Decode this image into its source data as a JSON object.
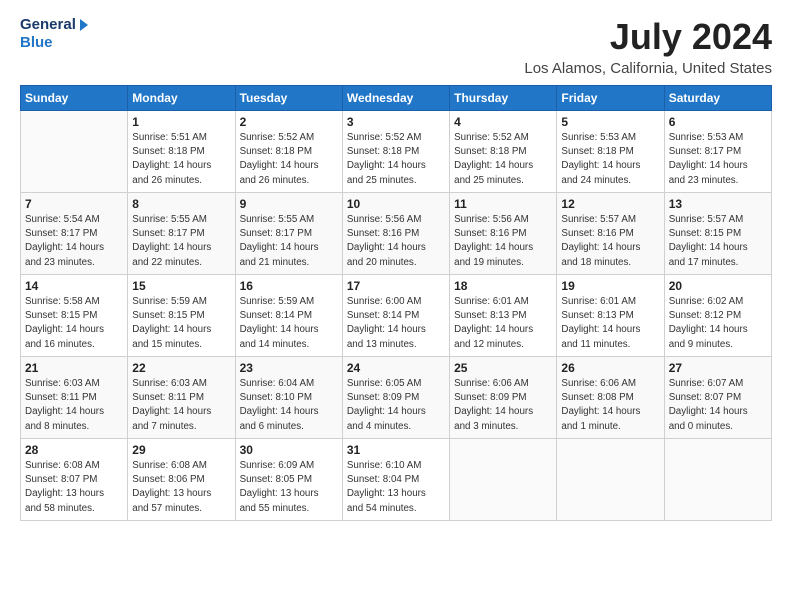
{
  "logo": {
    "general": "General",
    "blue": "Blue"
  },
  "title": "July 2024",
  "location": "Los Alamos, California, United States",
  "days_header": [
    "Sunday",
    "Monday",
    "Tuesday",
    "Wednesday",
    "Thursday",
    "Friday",
    "Saturday"
  ],
  "weeks": [
    [
      {
        "num": "",
        "info": ""
      },
      {
        "num": "1",
        "info": "Sunrise: 5:51 AM\nSunset: 8:18 PM\nDaylight: 14 hours\nand 26 minutes."
      },
      {
        "num": "2",
        "info": "Sunrise: 5:52 AM\nSunset: 8:18 PM\nDaylight: 14 hours\nand 26 minutes."
      },
      {
        "num": "3",
        "info": "Sunrise: 5:52 AM\nSunset: 8:18 PM\nDaylight: 14 hours\nand 25 minutes."
      },
      {
        "num": "4",
        "info": "Sunrise: 5:52 AM\nSunset: 8:18 PM\nDaylight: 14 hours\nand 25 minutes."
      },
      {
        "num": "5",
        "info": "Sunrise: 5:53 AM\nSunset: 8:18 PM\nDaylight: 14 hours\nand 24 minutes."
      },
      {
        "num": "6",
        "info": "Sunrise: 5:53 AM\nSunset: 8:17 PM\nDaylight: 14 hours\nand 23 minutes."
      }
    ],
    [
      {
        "num": "7",
        "info": "Sunrise: 5:54 AM\nSunset: 8:17 PM\nDaylight: 14 hours\nand 23 minutes."
      },
      {
        "num": "8",
        "info": "Sunrise: 5:55 AM\nSunset: 8:17 PM\nDaylight: 14 hours\nand 22 minutes."
      },
      {
        "num": "9",
        "info": "Sunrise: 5:55 AM\nSunset: 8:17 PM\nDaylight: 14 hours\nand 21 minutes."
      },
      {
        "num": "10",
        "info": "Sunrise: 5:56 AM\nSunset: 8:16 PM\nDaylight: 14 hours\nand 20 minutes."
      },
      {
        "num": "11",
        "info": "Sunrise: 5:56 AM\nSunset: 8:16 PM\nDaylight: 14 hours\nand 19 minutes."
      },
      {
        "num": "12",
        "info": "Sunrise: 5:57 AM\nSunset: 8:16 PM\nDaylight: 14 hours\nand 18 minutes."
      },
      {
        "num": "13",
        "info": "Sunrise: 5:57 AM\nSunset: 8:15 PM\nDaylight: 14 hours\nand 17 minutes."
      }
    ],
    [
      {
        "num": "14",
        "info": "Sunrise: 5:58 AM\nSunset: 8:15 PM\nDaylight: 14 hours\nand 16 minutes."
      },
      {
        "num": "15",
        "info": "Sunrise: 5:59 AM\nSunset: 8:15 PM\nDaylight: 14 hours\nand 15 minutes."
      },
      {
        "num": "16",
        "info": "Sunrise: 5:59 AM\nSunset: 8:14 PM\nDaylight: 14 hours\nand 14 minutes."
      },
      {
        "num": "17",
        "info": "Sunrise: 6:00 AM\nSunset: 8:14 PM\nDaylight: 14 hours\nand 13 minutes."
      },
      {
        "num": "18",
        "info": "Sunrise: 6:01 AM\nSunset: 8:13 PM\nDaylight: 14 hours\nand 12 minutes."
      },
      {
        "num": "19",
        "info": "Sunrise: 6:01 AM\nSunset: 8:13 PM\nDaylight: 14 hours\nand 11 minutes."
      },
      {
        "num": "20",
        "info": "Sunrise: 6:02 AM\nSunset: 8:12 PM\nDaylight: 14 hours\nand 9 minutes."
      }
    ],
    [
      {
        "num": "21",
        "info": "Sunrise: 6:03 AM\nSunset: 8:11 PM\nDaylight: 14 hours\nand 8 minutes."
      },
      {
        "num": "22",
        "info": "Sunrise: 6:03 AM\nSunset: 8:11 PM\nDaylight: 14 hours\nand 7 minutes."
      },
      {
        "num": "23",
        "info": "Sunrise: 6:04 AM\nSunset: 8:10 PM\nDaylight: 14 hours\nand 6 minutes."
      },
      {
        "num": "24",
        "info": "Sunrise: 6:05 AM\nSunset: 8:09 PM\nDaylight: 14 hours\nand 4 minutes."
      },
      {
        "num": "25",
        "info": "Sunrise: 6:06 AM\nSunset: 8:09 PM\nDaylight: 14 hours\nand 3 minutes."
      },
      {
        "num": "26",
        "info": "Sunrise: 6:06 AM\nSunset: 8:08 PM\nDaylight: 14 hours\nand 1 minute."
      },
      {
        "num": "27",
        "info": "Sunrise: 6:07 AM\nSunset: 8:07 PM\nDaylight: 14 hours\nand 0 minutes."
      }
    ],
    [
      {
        "num": "28",
        "info": "Sunrise: 6:08 AM\nSunset: 8:07 PM\nDaylight: 13 hours\nand 58 minutes."
      },
      {
        "num": "29",
        "info": "Sunrise: 6:08 AM\nSunset: 8:06 PM\nDaylight: 13 hours\nand 57 minutes."
      },
      {
        "num": "30",
        "info": "Sunrise: 6:09 AM\nSunset: 8:05 PM\nDaylight: 13 hours\nand 55 minutes."
      },
      {
        "num": "31",
        "info": "Sunrise: 6:10 AM\nSunset: 8:04 PM\nDaylight: 13 hours\nand 54 minutes."
      },
      {
        "num": "",
        "info": ""
      },
      {
        "num": "",
        "info": ""
      },
      {
        "num": "",
        "info": ""
      }
    ]
  ]
}
